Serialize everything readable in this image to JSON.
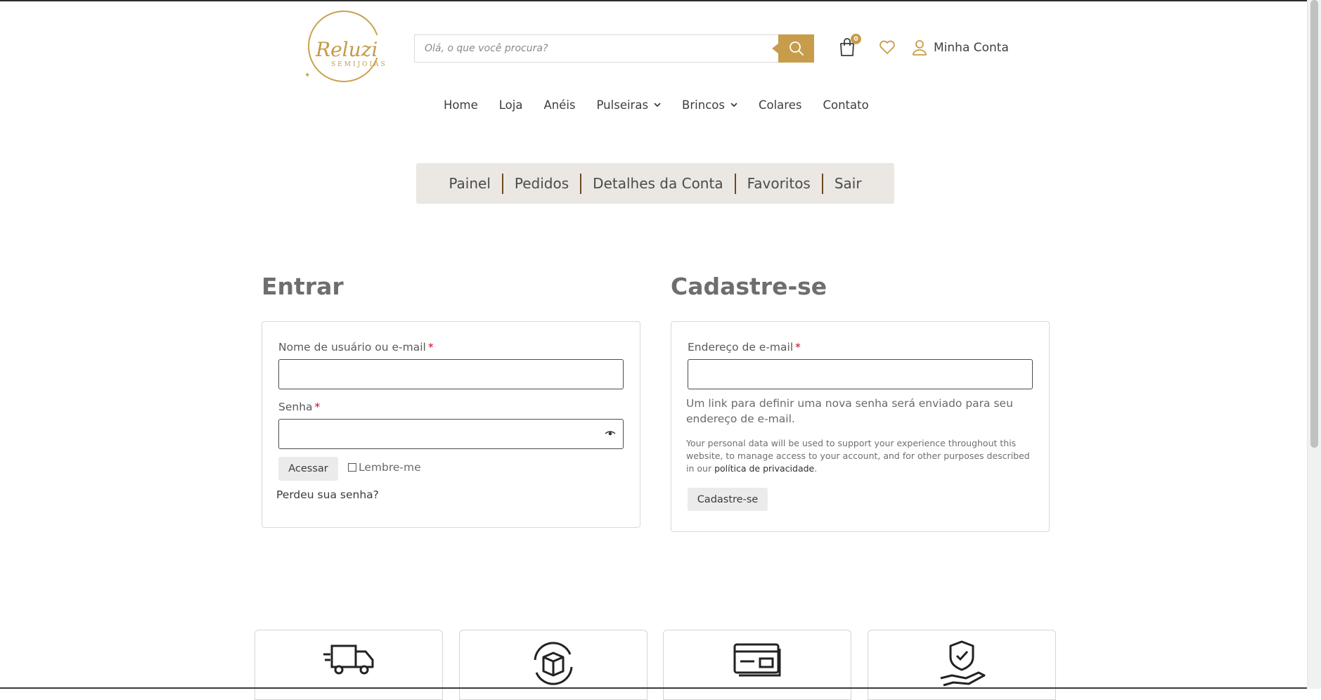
{
  "brand": {
    "logo_script": "Reluzi",
    "logo_sub": "SEMIJOIAS"
  },
  "colors": {
    "accent": "#c79c4b",
    "tabs_background": "#ebe8e3",
    "tab_separator": "#6b4a1f",
    "required": "#d0021b"
  },
  "header": {
    "search_placeholder": "Olá, o que você procura?",
    "search_icon": "search-icon",
    "cart_count": "0",
    "account_label": "Minha Conta"
  },
  "nav": {
    "items": [
      {
        "label": "Home"
      },
      {
        "label": "Loja"
      },
      {
        "label": "Anéis"
      },
      {
        "label": "Pulseiras"
      },
      {
        "label": "Brincos"
      },
      {
        "label": "Colares"
      },
      {
        "label": "Contato"
      }
    ]
  },
  "account_tabs": [
    "Painel",
    "Pedidos",
    "Detalhes da Conta",
    "Favoritos",
    "Sair"
  ],
  "login": {
    "title": "Entrar",
    "username_label": "Nome de usuário ou e-mail",
    "password_label": "Senha",
    "required_mark": "*",
    "submit": "Acessar",
    "remember": "Lembre-me",
    "lost_password": "Perdeu sua senha?"
  },
  "register": {
    "title": "Cadastre-se",
    "email_label": "Endereço de e-mail",
    "required_mark": "*",
    "info": "Um link para definir uma nova senha será enviado para seu endereço de e-mail.",
    "privacy_text": "Your personal data will be used to support your experience throughout this website, to manage access to your account, and for other purposes described in our",
    "privacy_link": "política de privacidade",
    "privacy_end": ".",
    "submit": "Cadastre-se"
  },
  "features": [
    {
      "icon": "delivery-truck-icon"
    },
    {
      "icon": "return-box-icon"
    },
    {
      "icon": "credit-card-icon"
    },
    {
      "icon": "secure-shield-hand-icon"
    }
  ]
}
